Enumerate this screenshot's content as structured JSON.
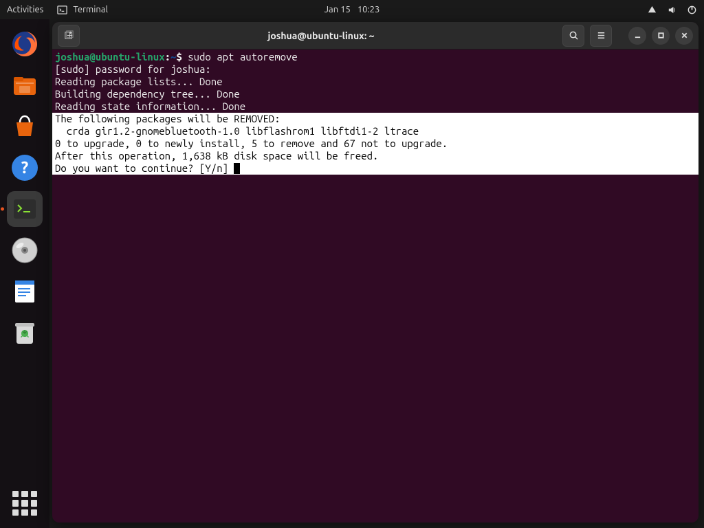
{
  "topbar": {
    "activities": "Activities",
    "app_name": "Terminal",
    "date": "Jan 15",
    "time": "10:23"
  },
  "window": {
    "title": "joshua@ubuntu-linux: ~"
  },
  "terminal": {
    "prompt_user": "joshua@ubuntu-linux",
    "prompt_path": "~",
    "prompt_symbol": "$",
    "command": "sudo apt autoremove",
    "lines": [
      "[sudo] password for joshua: ",
      "Reading package lists... Done",
      "Building dependency tree... Done",
      "Reading state information... Done"
    ],
    "highlight": [
      "The following packages will be REMOVED:",
      "  crda gir1.2-gnomebluetooth-1.0 libflashrom1 libftdi1-2 ltrace",
      "0 to upgrade, 0 to newly install, 5 to remove and 67 not to upgrade.",
      "After this operation, 1,638 kB disk space will be freed.",
      "Do you want to continue? [Y/n] "
    ]
  }
}
